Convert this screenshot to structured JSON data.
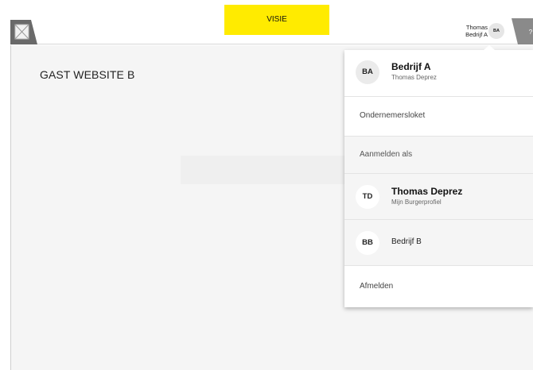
{
  "header": {
    "banner_label": "VISIE",
    "user_first_name": "Thomas",
    "user_org": "Bedrijf A",
    "user_initials": "BA",
    "help_icon": "?"
  },
  "page": {
    "title": "GAST WEBSITE B"
  },
  "menu": {
    "current": {
      "initials": "BA",
      "name": "Bedrijf A",
      "subtitle": "Thomas Deprez"
    },
    "ondernemersloket": "Ondernemersloket",
    "aanmelden_als": "Aanmelden als",
    "accounts": [
      {
        "initials": "TD",
        "name": "Thomas Deprez",
        "subtitle": "Mijn Burgerprofiel"
      },
      {
        "initials": "BB",
        "name": "Bedrijf B"
      }
    ],
    "afmelden": "Afmelden"
  },
  "colors": {
    "banner": "#ffeb00",
    "content_bg": "#f5f5f5",
    "help_tab": "#8a8a8a"
  },
  "icons": {
    "logo": "image-placeholder-icon",
    "help": "question-icon"
  }
}
